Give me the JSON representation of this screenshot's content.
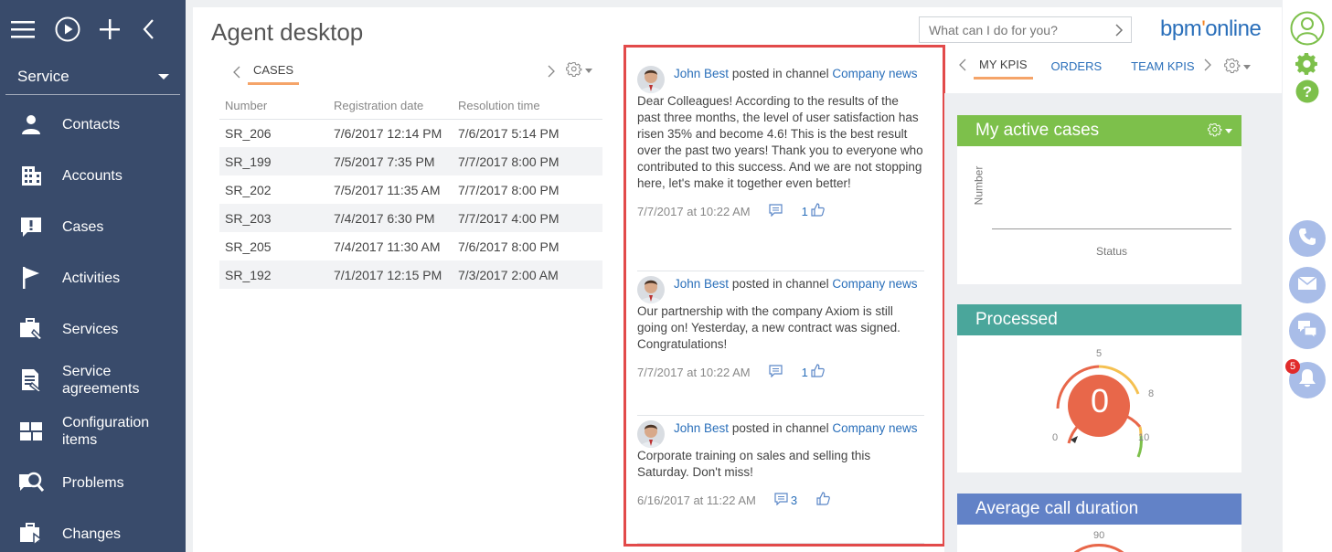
{
  "sidebar": {
    "section": "Service",
    "items": [
      {
        "label": "Contacts"
      },
      {
        "label": "Accounts"
      },
      {
        "label": "Cases"
      },
      {
        "label": "Activities"
      },
      {
        "label": "Services"
      },
      {
        "label": "Service agreements"
      },
      {
        "label": "Configuration items"
      },
      {
        "label": "Problems"
      },
      {
        "label": "Changes"
      }
    ]
  },
  "header": {
    "title": "Agent desktop",
    "search_placeholder": "What can I do for you?",
    "logo_main": "bpm",
    "logo_dot": "'",
    "logo_rest": "online"
  },
  "cases": {
    "tab": "CASES",
    "columns": [
      "Number",
      "Registration date",
      "Resolution time"
    ],
    "rows": [
      [
        "SR_206",
        "7/6/2017 12:14 PM",
        "7/6/2017 5:14 PM"
      ],
      [
        "SR_199",
        "7/5/2017 7:35 PM",
        "7/7/2017 8:00 PM"
      ],
      [
        "SR_202",
        "7/5/2017 11:35 AM",
        "7/7/2017 8:00 PM"
      ],
      [
        "SR_203",
        "7/4/2017 6:30 PM",
        "7/7/2017 4:00 PM"
      ],
      [
        "SR_205",
        "7/4/2017 11:30 AM",
        "7/6/2017 8:00 PM"
      ],
      [
        "SR_192",
        "7/1/2017 12:15 PM",
        "7/3/2017 2:00 AM"
      ]
    ]
  },
  "feed": {
    "posts": [
      {
        "author": "John Best",
        "action": "posted in channel",
        "channel": "Company news",
        "body": "Dear Colleagues! According to the results of the past three months, the level of user satisfaction has risen 35% and become 4.6! This is the best result over the past two years! Thank you to everyone who contributed to this success. And we are not stopping here, let's make it together even better!",
        "date": "7/7/2017 at 10:22 AM",
        "comments": "",
        "likes": "1"
      },
      {
        "author": "John Best",
        "action": "posted in channel",
        "channel": "Company news",
        "body": "Our partnership with the company Axiom is still going on! Yesterday, a new contract was signed. Congratulations!",
        "date": "7/7/2017 at 10:22 AM",
        "comments": "",
        "likes": "1"
      },
      {
        "author": "John Best",
        "action": "posted in channel",
        "channel": "Company news",
        "body": "Corporate training on sales and selling this Saturday. Don't miss!",
        "date": "6/16/2017 at 11:22 AM",
        "comments": "3",
        "likes": ""
      }
    ]
  },
  "kpi": {
    "tabs": [
      "MY KPIS",
      "ORDERS",
      "TEAM KPIS"
    ],
    "active_cases": {
      "title": "My active cases",
      "ylabel": "Number",
      "xlabel": "Status",
      "color": "#7dc04b"
    },
    "processed": {
      "title": "Processed",
      "value": "0",
      "scale_min": "0",
      "scale_low": "5",
      "scale_high": "8",
      "scale_max": "10",
      "color": "#4aa69b",
      "gauge_color": "#e8674a"
    },
    "avg_call": {
      "title": "Average call duration",
      "scale_label": "90",
      "color": "#6282c7"
    }
  },
  "rail": {
    "notification_count": "5"
  }
}
